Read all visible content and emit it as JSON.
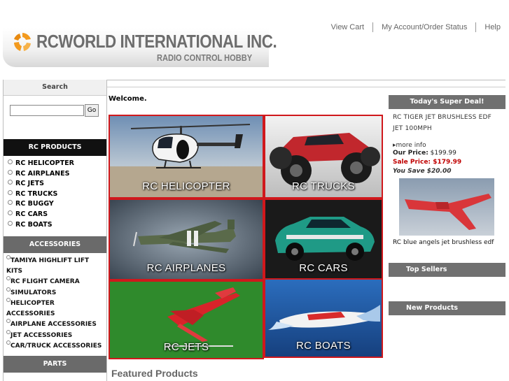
{
  "header": {
    "brand_name": "RCWORLD INTERNATIONAL INC.",
    "tagline": "RADIO CONTROL HOBBY",
    "links": [
      "View Cart",
      "My Account/Order Status",
      "Help"
    ]
  },
  "sidebar": {
    "search_title": "Search",
    "search_value": "",
    "go_label": "Go",
    "rc_products_title": "RC PRODUCTS",
    "rc_products": [
      "RC HELICOPTER",
      "RC AIRPLANES",
      "RC JETS",
      "RC TRUCKS",
      "RC BUGGY",
      "RC CARS",
      "RC BOATS"
    ],
    "accessories_title": "ACCESSORIES",
    "accessories": [
      "TAMIYA HIGHLIFT LIFT KITS",
      "RC FLIGHT CAMERA",
      "SIMULATORS",
      "HELICOPTER ACCESSORIES",
      "AIRPLANE ACCESSORIES",
      "JET ACCESSORIES",
      "CAR/TRUCK ACCESSORIES"
    ],
    "parts_title": "PARTS"
  },
  "main": {
    "welcome": "Welcome.",
    "tiles": [
      "RC HELICOPTER",
      "RC TRUCKS",
      "RC AIRPLANES",
      "RC CARS",
      "RC JETS",
      "RC BOATS"
    ],
    "featured_title": "Featured Products"
  },
  "right": {
    "deal_title": "Today's Super Deal!",
    "deal_name": "RC TIGER JET BRUSHLESS EDF JET 100MPH",
    "more_info": "more info",
    "our_price_label": "Our Price:",
    "our_price": "$199.99",
    "sale_price_label": "Sale Price:",
    "sale_price": "$179.99",
    "you_save": "You Save $20.00",
    "deal_caption": "RC blue angels jet brushless edf",
    "top_sellers_title": "Top Sellers",
    "new_products_title": "New Products"
  },
  "colors": {
    "accent_red": "#d0181c",
    "dark_gray": "#6a6a6a",
    "logo_orange": "#f39a1e",
    "sale_red": "#c00000"
  }
}
